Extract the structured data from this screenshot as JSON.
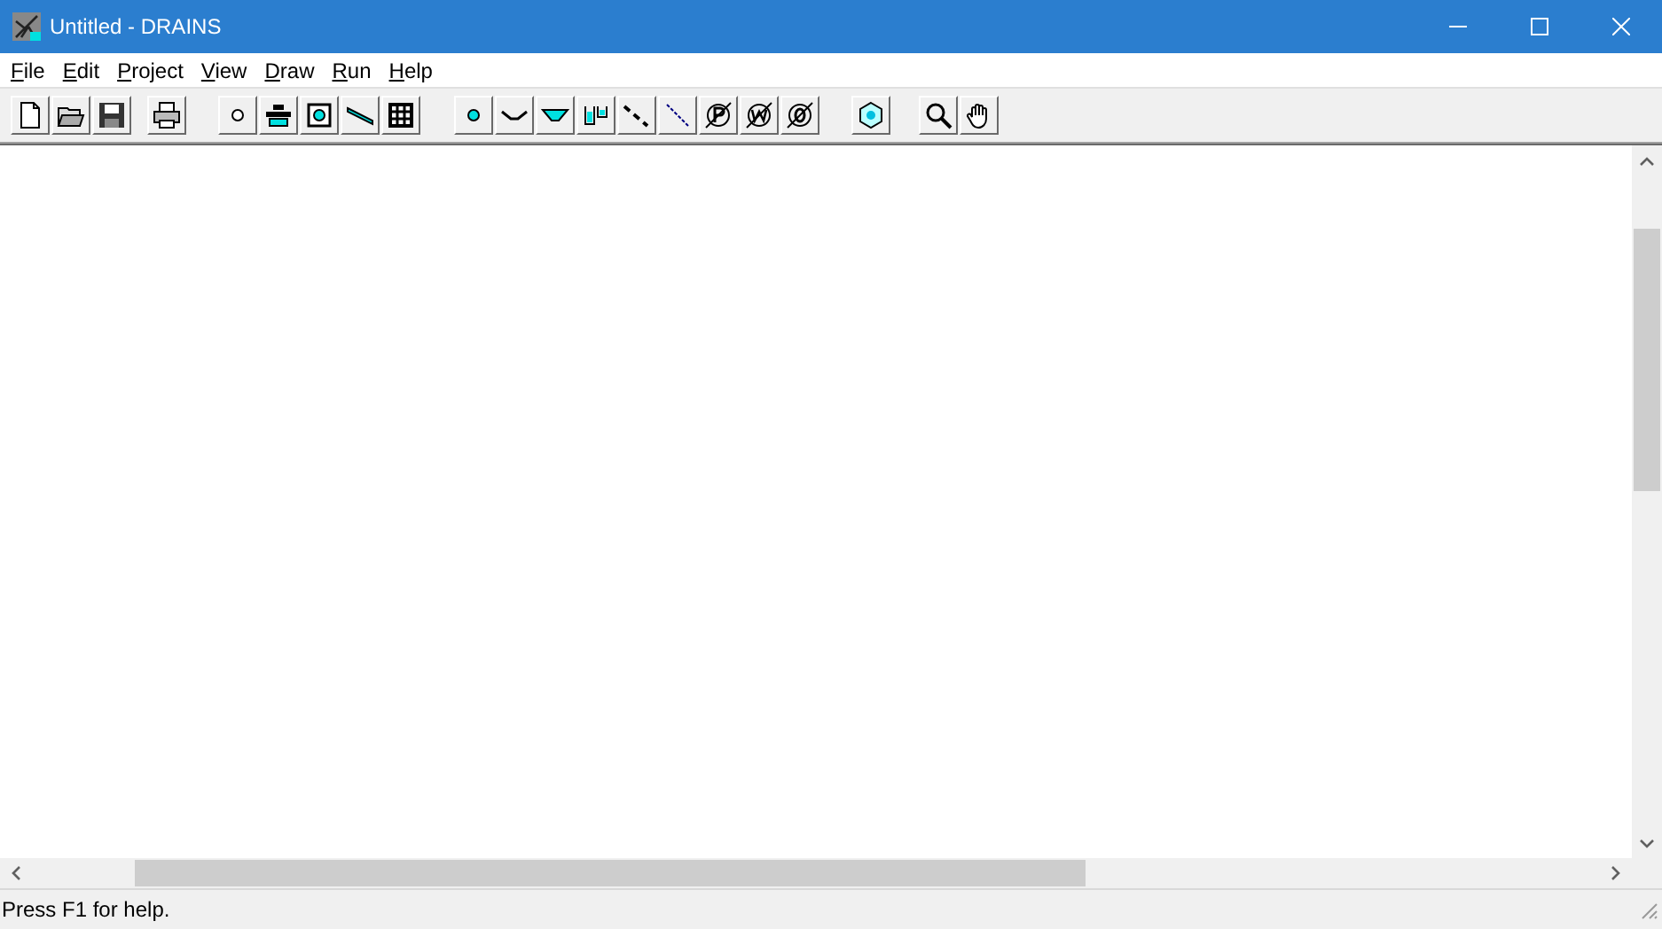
{
  "window": {
    "title": "Untitled - DRAINS"
  },
  "menu": [
    {
      "label": "File"
    },
    {
      "label": "Edit"
    },
    {
      "label": "Project"
    },
    {
      "label": "View"
    },
    {
      "label": "Draw"
    },
    {
      "label": "Run"
    },
    {
      "label": "Help"
    }
  ],
  "toolbar": [
    {
      "buttons": [
        {
          "kind": "new"
        },
        {
          "kind": "open"
        },
        {
          "kind": "save"
        }
      ]
    },
    {
      "buttons": [
        {
          "kind": "print"
        }
      ]
    },
    {
      "buttons": [
        {
          "kind": "node"
        },
        {
          "kind": "pit"
        },
        {
          "kind": "basin"
        },
        {
          "kind": "storage"
        },
        {
          "kind": "grid"
        }
      ]
    },
    {
      "buttons": [
        {
          "kind": "dot"
        },
        {
          "kind": "channel"
        },
        {
          "kind": "filled-channel"
        },
        {
          "kind": "tanks"
        },
        {
          "kind": "dashed-link"
        },
        {
          "kind": "thin-link"
        },
        {
          "kind": "p-symbol"
        },
        {
          "kind": "w-symbol"
        },
        {
          "kind": "o-symbol"
        }
      ]
    },
    {
      "buttons": [
        {
          "kind": "hexagon"
        }
      ]
    },
    {
      "buttons": [
        {
          "kind": "zoom"
        },
        {
          "kind": "pan"
        }
      ]
    }
  ],
  "status_bar": {
    "text": "Press F1 for help."
  }
}
